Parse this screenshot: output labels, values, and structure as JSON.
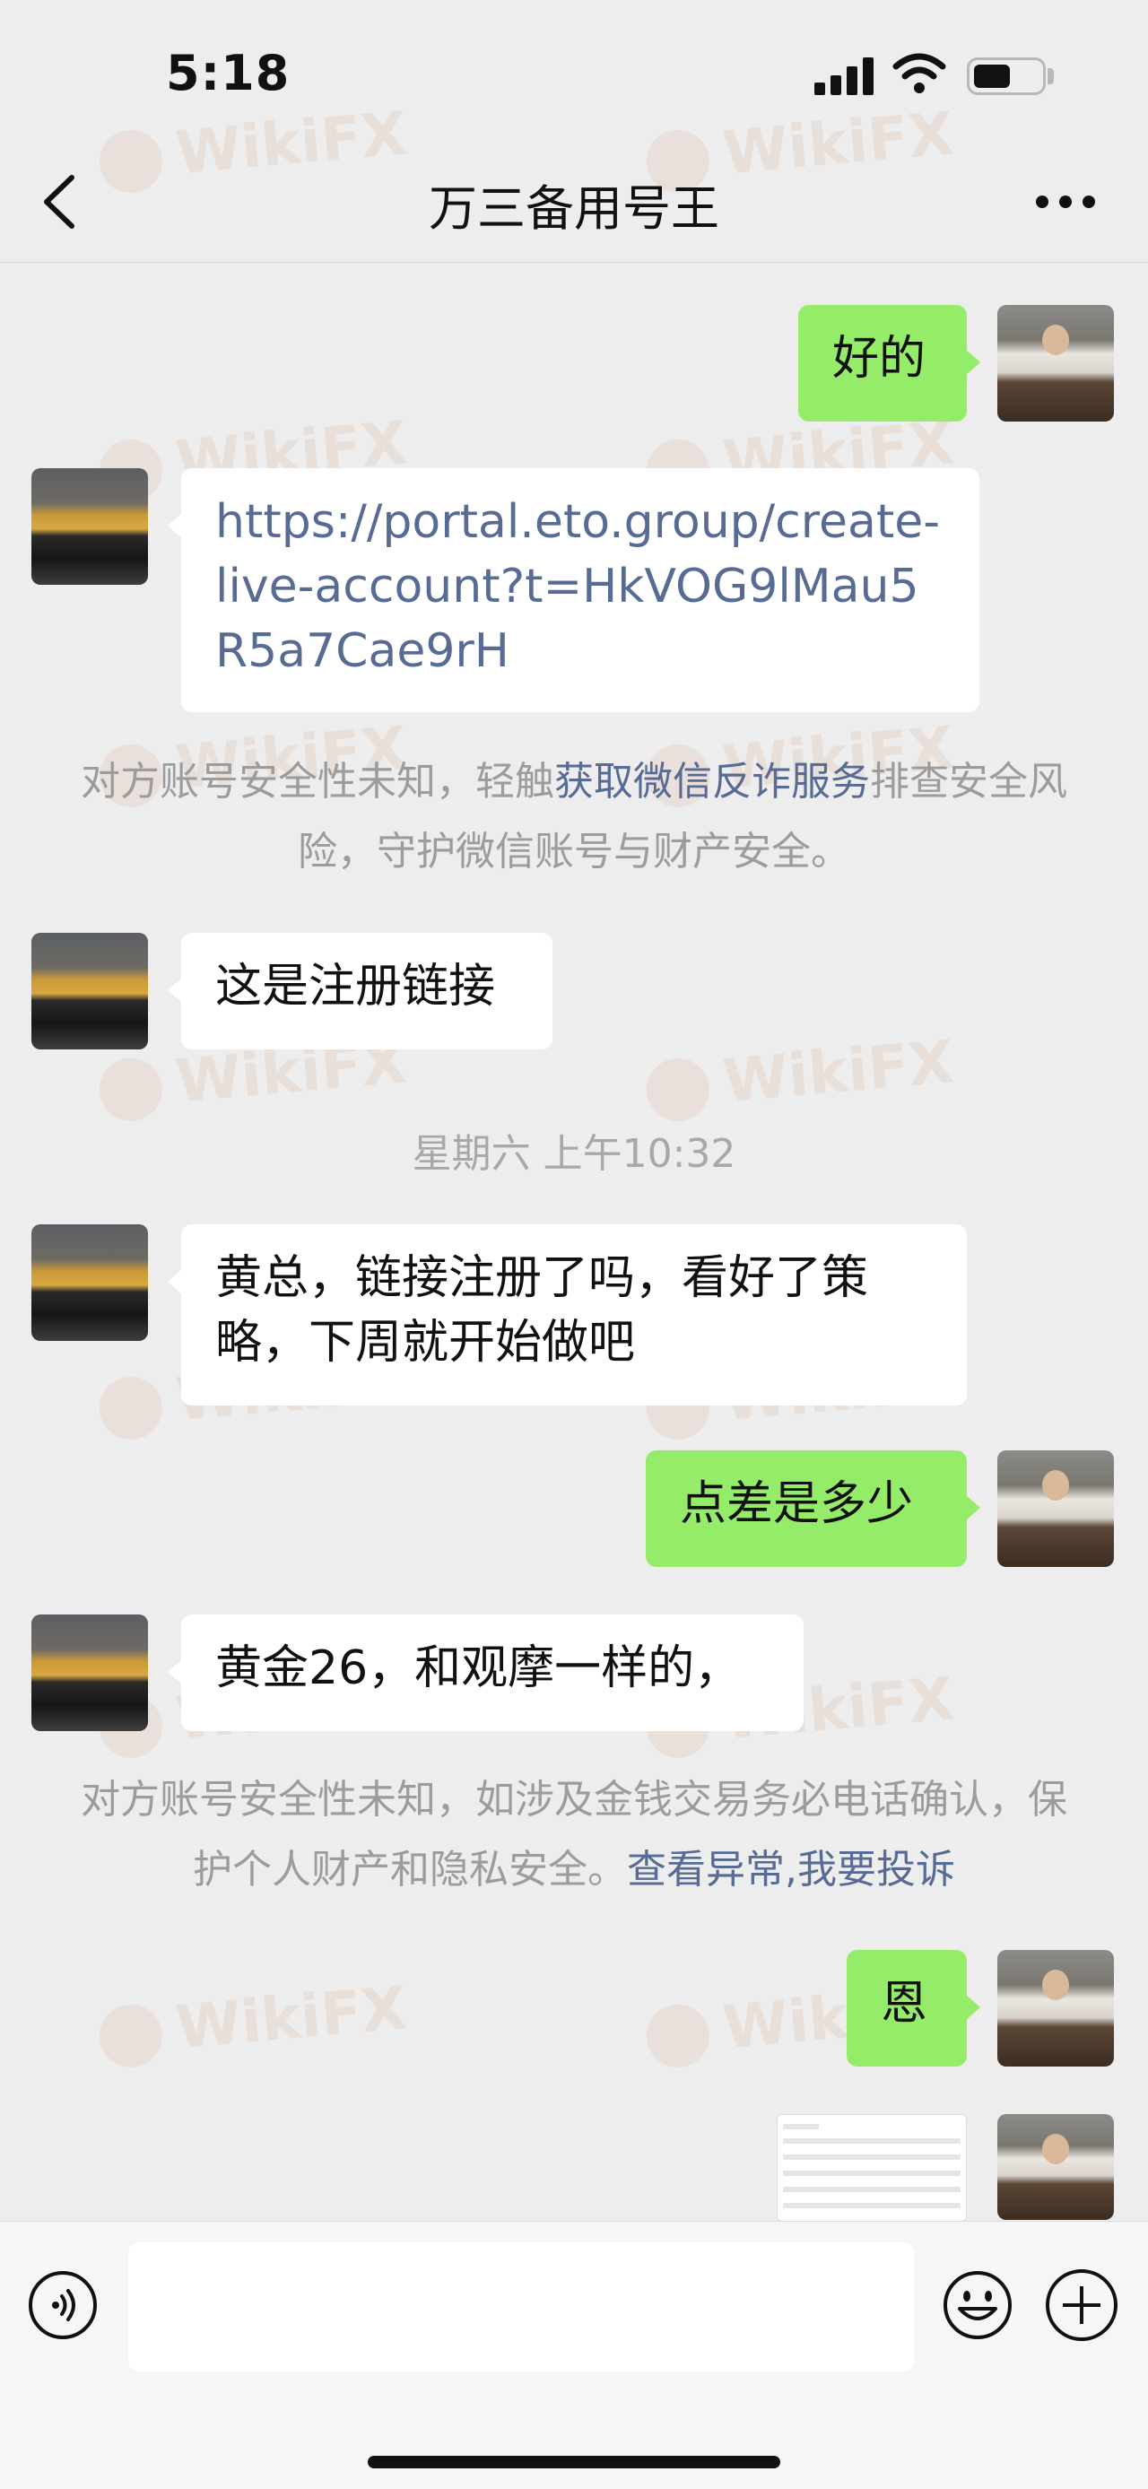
{
  "status_bar": {
    "time": "5:18"
  },
  "header": {
    "title": "万三备用号王"
  },
  "messages": [
    {
      "side": "out",
      "text": "好的"
    },
    {
      "side": "in",
      "text": "https://portal.eto.group/create-live-account?t=HkVOG9lMau5R5a7Cae9rH",
      "kind": "link"
    },
    {
      "side": "in",
      "text": "这是注册链接"
    },
    {
      "side": "in",
      "text": "黄总，链接注册了吗，看好了策略，下周就开始做吧"
    },
    {
      "side": "out",
      "text": "点差是多少"
    },
    {
      "side": "in",
      "text": "黄金26，和观摩一样的，"
    },
    {
      "side": "out",
      "text": "恩"
    }
  ],
  "notices": {
    "first": {
      "prefix": "对方账号安全性未知，轻触",
      "link": "获取微信反诈服务",
      "suffix": "排查安全风险，守护微信账号与财产安全。"
    },
    "second": {
      "text": "对方账号安全性未知，如涉及金钱交易务必电话确认，保护个人财产和隐私安全。",
      "link1": "查看异常",
      "sep": ",",
      "link2": "我要投诉"
    }
  },
  "timestamp": "星期六 上午10:32",
  "watermark": "WikiFX",
  "colors": {
    "background": "#ededed",
    "outgoing_bubble": "#95ec69",
    "incoming_bubble": "#ffffff",
    "link": "#576b95"
  },
  "icons": [
    "back-chevron-icon",
    "more-dots-icon",
    "voice-icon",
    "emoji-icon",
    "plus-icon"
  ]
}
